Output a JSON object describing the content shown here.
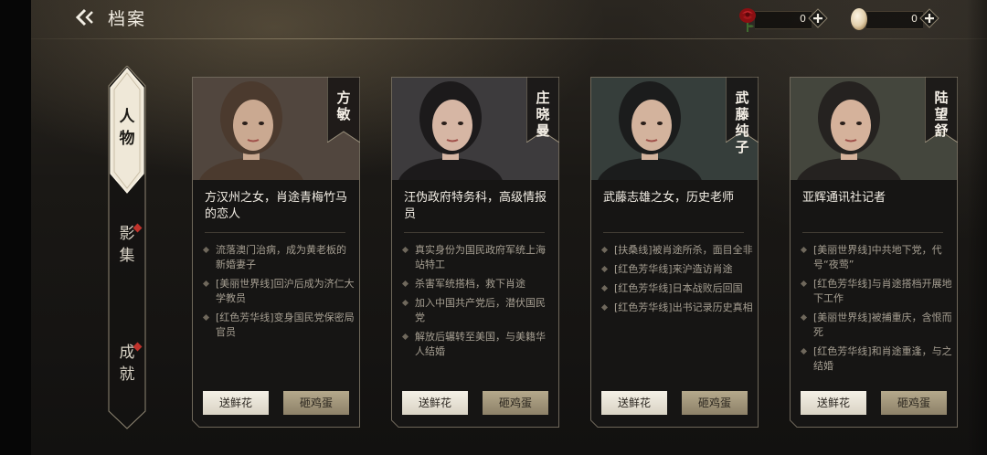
{
  "header": {
    "title": "档案",
    "resources": [
      {
        "name": "flower",
        "value": "0",
        "icon": "rose-icon"
      },
      {
        "name": "egg",
        "value": "0",
        "icon": "egg-icon"
      }
    ]
  },
  "side_tabs": [
    {
      "label": "人物",
      "active": true,
      "badge": false
    },
    {
      "label": "影集",
      "active": false,
      "badge": true
    },
    {
      "label": "成就",
      "active": false,
      "badge": true
    }
  ],
  "cards": [
    {
      "name": "方敏",
      "summary": "方汉州之女，肖途青梅竹马的恋人",
      "details": [
        "流落澳门治病，成为黄老板的新婚妻子",
        "[美丽世界线]回沪后成为济仁大学教员",
        "[红色芳华线]变身国民党保密局官员"
      ],
      "flower_label": "送鲜花",
      "egg_label": "砸鸡蛋"
    },
    {
      "name": "庄晓曼",
      "summary": "汪伪政府特务科，高级情报员",
      "details": [
        "真实身份为国民政府军统上海站特工",
        "杀害军统搭档，救下肖途",
        "加入中国共产党后，潜伏国民党",
        "解放后辗转至美国，与美籍华人结婚"
      ],
      "flower_label": "送鲜花",
      "egg_label": "砸鸡蛋"
    },
    {
      "name": "武藤纯子",
      "summary": "武藤志雄之女，历史老师",
      "details": [
        "[扶桑线]被肖途所杀，面目全非",
        "[红色芳华线]来沪造访肖途",
        "[红色芳华线]日本战败后回国",
        "[红色芳华线]出书记录历史真相"
      ],
      "flower_label": "送鲜花",
      "egg_label": "砸鸡蛋"
    },
    {
      "name": "陆望舒",
      "summary": "亚辉通讯社记者",
      "details": [
        "[美丽世界线]中共地下党，代号“夜莺”",
        "[红色芳华线]与肖途搭档开展地下工作",
        "[美丽世界线]被捕重庆，含恨而死",
        "[红色芳华线]和肖途重逢，与之结婚"
      ],
      "flower_label": "送鲜花",
      "egg_label": "砸鸡蛋"
    }
  ],
  "colors": {
    "accent_gold": "#b5a98c",
    "badge_red": "#c0332c",
    "card_bg": "#161514"
  }
}
